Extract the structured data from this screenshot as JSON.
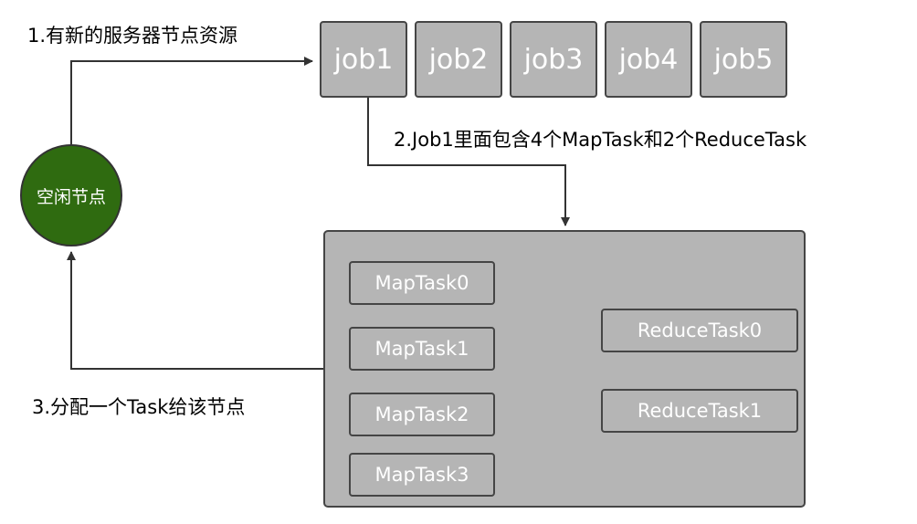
{
  "annotations": {
    "step1": "1.有新的服务器节点资源",
    "step2": "2.Job1里面包含4个MapTask和2个ReduceTask",
    "step3": "3.分配一个Task给该节点"
  },
  "jobs": [
    "job1",
    "job2",
    "job3",
    "job4",
    "job5"
  ],
  "idle_node": {
    "label": "空闲节点",
    "color": "#2f6b10"
  },
  "job1_detail": {
    "map_tasks": [
      "MapTask0",
      "MapTask1",
      "MapTask2",
      "MapTask3"
    ],
    "reduce_tasks": [
      "ReduceTask0",
      "ReduceTask1"
    ]
  },
  "colors": {
    "box_fill": "#b5b5b5",
    "box_border": "#454545",
    "connector": "#333333"
  }
}
